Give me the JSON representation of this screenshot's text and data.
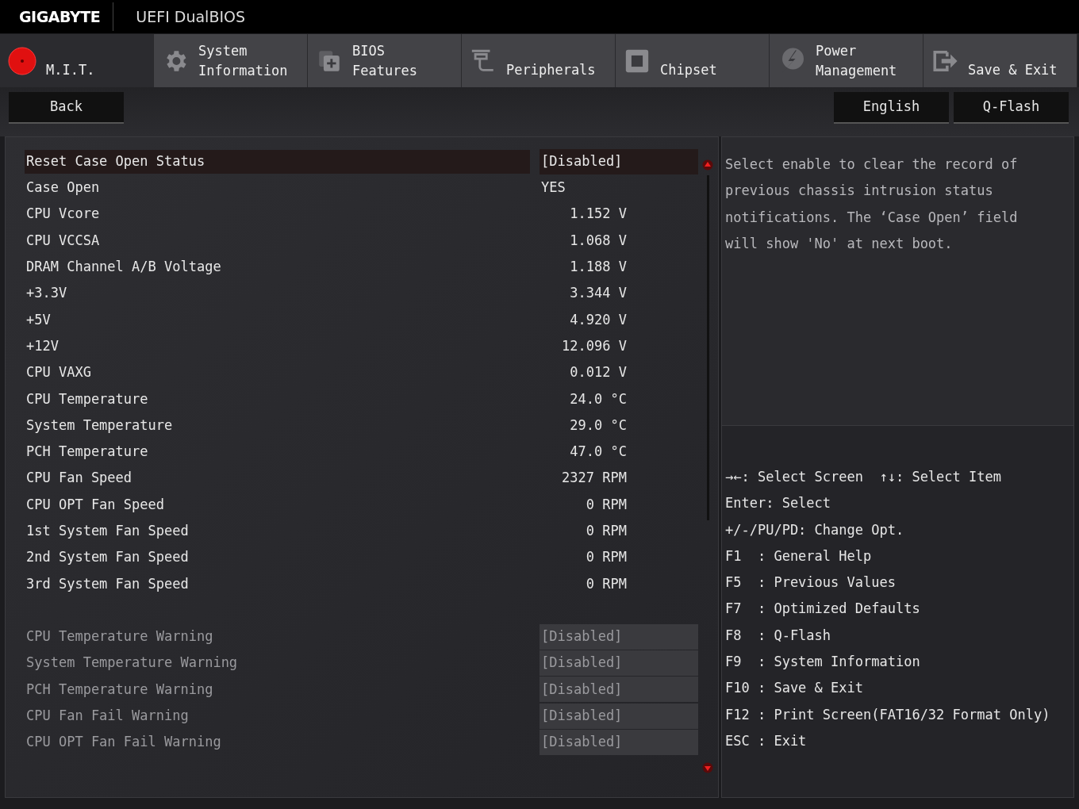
{
  "header": {
    "logo": "GIGABYTE",
    "product": "UEFI DualBIOS"
  },
  "tabs": [
    {
      "lines": [
        "M.I.T."
      ],
      "selected": true
    },
    {
      "lines": [
        "System",
        "Information"
      ],
      "selected": false
    },
    {
      "lines": [
        "BIOS",
        "Features"
      ],
      "selected": false
    },
    {
      "lines": [
        "Peripherals"
      ],
      "selected": false
    },
    {
      "lines": [
        "Chipset"
      ],
      "selected": false
    },
    {
      "lines": [
        "Power",
        "Management"
      ],
      "selected": false
    },
    {
      "lines": [
        "Save & Exit"
      ],
      "selected": false
    }
  ],
  "toolbar": {
    "back": "Back",
    "right_buttons": [
      "English",
      "Q-Flash"
    ]
  },
  "settings": [
    {
      "kind": "option",
      "label": "Reset Case Open Status",
      "value": "[Disabled]",
      "selected": true,
      "disabled": false
    },
    {
      "kind": "info",
      "label": "Case Open",
      "value": "YES",
      "selected": false,
      "disabled": false
    },
    {
      "kind": "reading",
      "label": "CPU Vcore",
      "value": "1.152 V",
      "selected": false,
      "disabled": false
    },
    {
      "kind": "reading",
      "label": "CPU VCCSA",
      "value": "1.068 V",
      "selected": false,
      "disabled": false
    },
    {
      "kind": "reading",
      "label": "DRAM Channel A/B Voltage",
      "value": "1.188 V",
      "selected": false,
      "disabled": false
    },
    {
      "kind": "reading",
      "label": "+3.3V",
      "value": "3.344 V",
      "selected": false,
      "disabled": false
    },
    {
      "kind": "reading",
      "label": "+5V",
      "value": "4.920 V",
      "selected": false,
      "disabled": false
    },
    {
      "kind": "reading",
      "label": "+12V",
      "value": "12.096 V",
      "selected": false,
      "disabled": false
    },
    {
      "kind": "reading",
      "label": "CPU VAXG",
      "value": "0.012 V",
      "selected": false,
      "disabled": false
    },
    {
      "kind": "reading",
      "label": "CPU Temperature",
      "value": "24.0 °C",
      "selected": false,
      "disabled": false
    },
    {
      "kind": "reading",
      "label": "System Temperature",
      "value": "29.0 °C",
      "selected": false,
      "disabled": false
    },
    {
      "kind": "reading",
      "label": "PCH Temperature",
      "value": "47.0 °C",
      "selected": false,
      "disabled": false
    },
    {
      "kind": "reading",
      "label": "CPU Fan Speed",
      "value": "2327 RPM",
      "selected": false,
      "disabled": false
    },
    {
      "kind": "reading",
      "label": "CPU OPT Fan Speed",
      "value": "0 RPM",
      "selected": false,
      "disabled": false
    },
    {
      "kind": "reading",
      "label": "1st System Fan Speed",
      "value": "0 RPM",
      "selected": false,
      "disabled": false
    },
    {
      "kind": "reading",
      "label": "2nd System Fan Speed",
      "value": "0 RPM",
      "selected": false,
      "disabled": false
    },
    {
      "kind": "reading",
      "label": "3rd System Fan Speed",
      "value": "0 RPM",
      "selected": false,
      "disabled": false
    },
    {
      "kind": "gap"
    },
    {
      "kind": "option",
      "label": "CPU Temperature Warning",
      "value": "[Disabled]",
      "selected": false,
      "disabled": true
    },
    {
      "kind": "option",
      "label": "System Temperature Warning",
      "value": "[Disabled]",
      "selected": false,
      "disabled": true
    },
    {
      "kind": "option",
      "label": "PCH Temperature Warning",
      "value": "[Disabled]",
      "selected": false,
      "disabled": true
    },
    {
      "kind": "option",
      "label": "CPU Fan Fail Warning",
      "value": "[Disabled]",
      "selected": false,
      "disabled": true
    },
    {
      "kind": "option",
      "label": "CPU OPT Fan Fail Warning",
      "value": "[Disabled]",
      "selected": false,
      "disabled": true
    }
  ],
  "help": "Select enable to clear the record of previous chassis intrusion status notifications. The ‘Case Open’ field will show 'No' at next boot.",
  "key_help": [
    "→←: Select Screen  ↑↓: Select Item",
    "Enter: Select",
    "+/-/PU/PD: Change Opt.",
    "F1  : General Help",
    "F5  : Previous Values",
    "F7  : Optimized Defaults",
    "F8  : Q-Flash",
    "F9  : System Information",
    "F10 : Save & Exit",
    "F12 : Print Screen(FAT16/32 Format Only)",
    "ESC : Exit"
  ]
}
